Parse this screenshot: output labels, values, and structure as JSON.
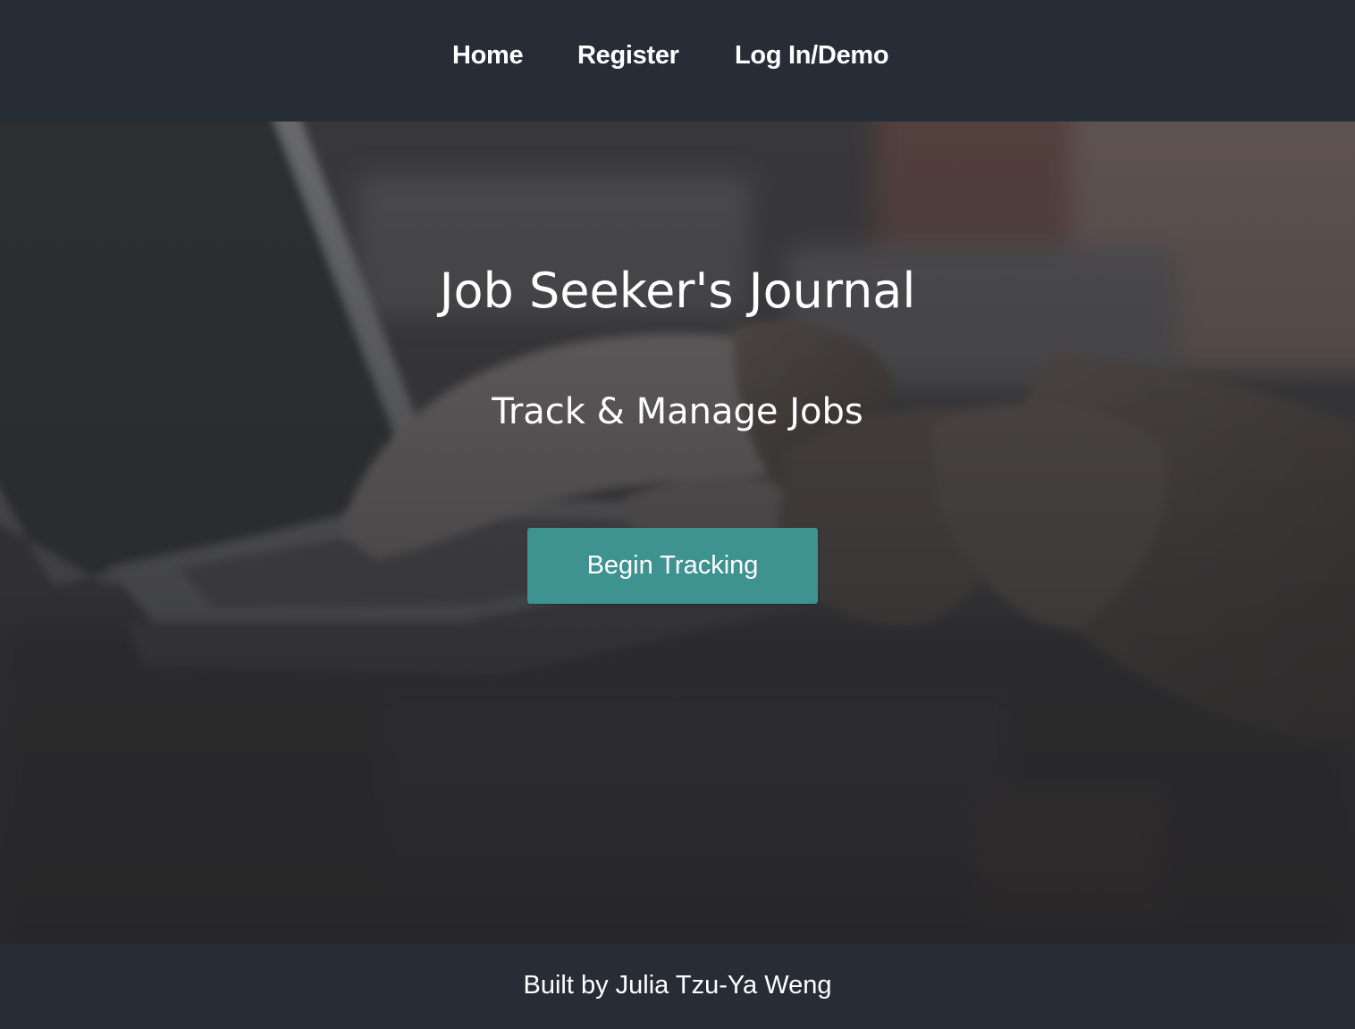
{
  "nav": {
    "home_label": "Home",
    "register_label": "Register",
    "login_label": "Log In/Demo"
  },
  "hero": {
    "title": "Job Seeker's Journal",
    "subtitle": "Track & Manage Jobs",
    "cta_label": "Begin Tracking"
  },
  "footer": {
    "credit": "Built by Julia Tzu-Ya Weng"
  },
  "colors": {
    "nav_background": "#272d37",
    "accent_button": "#3e9391",
    "text": "#ffffff"
  }
}
